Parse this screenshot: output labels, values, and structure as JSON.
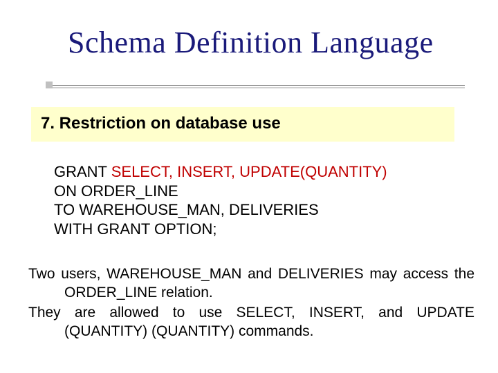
{
  "title": "Schema Definition Language",
  "section_heading": "7. Restriction on database use",
  "code": {
    "l1a": "GRANT ",
    "l1b": "SELECT, INSERT, UPDATE(QUANTITY)",
    "l2": "ON ORDER_LINE",
    "l3": "TO WAREHOUSE_MAN, DELIVERIES",
    "l4": "WITH GRANT OPTION;"
  },
  "body": {
    "p1": "Two users, WAREHOUSE_MAN and DELIVERIES may access the ORDER_LINE relation.",
    "p2": "They are allowed to use SELECT, INSERT, and UPDATE (QUANTITY) (QUANTITY) commands."
  }
}
